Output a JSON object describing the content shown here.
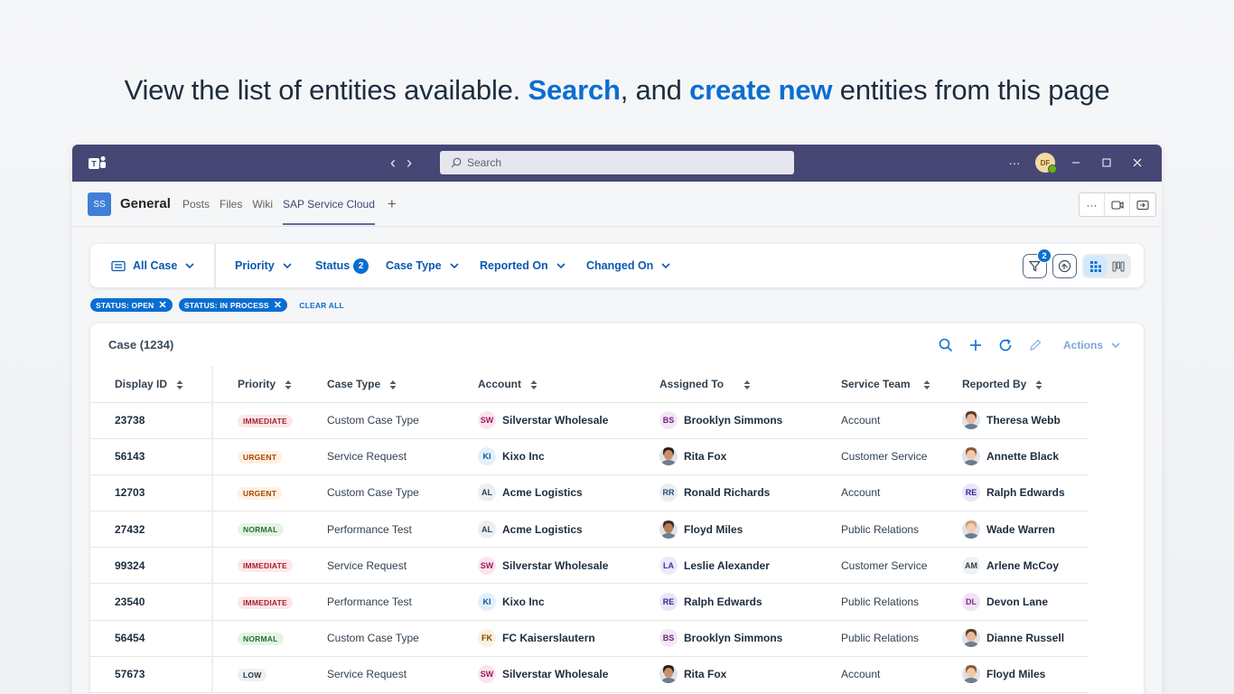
{
  "headline": {
    "part1": "View the list of entities available. ",
    "part2": "Search",
    "part3": ", and ",
    "part4": "create new",
    "part5": " entities from this page"
  },
  "titlebar": {
    "search_placeholder": "Search",
    "avatar_initials": "DF",
    "more": "···"
  },
  "channel": {
    "badge": "SS",
    "title": "General",
    "tabs": [
      "Posts",
      "Files",
      "Wiki",
      "SAP Service Cloud"
    ],
    "active_tab": "SAP Service Cloud",
    "more": "···"
  },
  "filterbar": {
    "variant": "All Case",
    "filters": [
      {
        "label": "Priority"
      },
      {
        "label": "Status",
        "count": "2"
      },
      {
        "label": "Case Type"
      },
      {
        "label": "Reported On"
      },
      {
        "label": "Changed On"
      }
    ],
    "filter_badge": "2"
  },
  "chips": [
    "STATUS: OPEN",
    "STATUS: IN PROCESS"
  ],
  "clear_all": "CLEAR ALL",
  "card": {
    "title": "Case (1234)",
    "actions_label": "Actions"
  },
  "table": {
    "columns": [
      "Display ID",
      "Priority",
      "Case Type",
      "Account",
      "Assigned To",
      "Service Team",
      "Reported By"
    ],
    "rows": [
      {
        "id": "23738",
        "priority": "IMMEDIATE",
        "case_type": "Custom Case Type",
        "account": "Silverstar Wholesale",
        "account_ini": "SW",
        "assigned": "Brooklyn Simmons",
        "assigned_ini": "BS",
        "team": "Account",
        "reported": "Theresa Webb",
        "reported_ini": ""
      },
      {
        "id": "56143",
        "priority": "URGENT",
        "case_type": "Service Request",
        "account": "Kixo Inc",
        "account_ini": "KI",
        "assigned": "Rita Fox",
        "assigned_ini": "",
        "team": "Customer Service",
        "reported": "Annette Black",
        "reported_ini": ""
      },
      {
        "id": "12703",
        "priority": "URGENT",
        "case_type": "Custom Case Type",
        "account": "Acme Logistics",
        "account_ini": "AL",
        "assigned": "Ronald Richards",
        "assigned_ini": "RR",
        "team": "Account",
        "reported": "Ralph Edwards",
        "reported_ini": "RE"
      },
      {
        "id": "27432",
        "priority": "NORMAL",
        "case_type": "Performance Test",
        "account": "Acme Logistics",
        "account_ini": "AL",
        "assigned": "Floyd Miles",
        "assigned_ini": "",
        "team": "Public Relations",
        "reported": "Wade Warren",
        "reported_ini": ""
      },
      {
        "id": "99324",
        "priority": "IMMEDIATE",
        "case_type": "Service Request",
        "account": "Silverstar Wholesale",
        "account_ini": "SW",
        "assigned": "Leslie Alexander",
        "assigned_ini": "LA",
        "team": "Customer Service",
        "reported": "Arlene McCoy",
        "reported_ini": "AM"
      },
      {
        "id": "23540",
        "priority": "IMMEDIATE",
        "case_type": "Performance Test",
        "account": "Kixo Inc",
        "account_ini": "KI",
        "assigned": "Ralph Edwards",
        "assigned_ini": "RE",
        "team": "Public Relations",
        "reported": "Devon Lane",
        "reported_ini": "DL"
      },
      {
        "id": "56454",
        "priority": "NORMAL",
        "case_type": "Custom Case Type",
        "account": "FC Kaiserslautern",
        "account_ini": "FK",
        "assigned": "Brooklyn Simmons",
        "assigned_ini": "BS",
        "team": "Public Relations",
        "reported": "Dianne Russell",
        "reported_ini": ""
      },
      {
        "id": "57673",
        "priority": "LOW",
        "case_type": "Service Request",
        "account": "Silverstar Wholesale",
        "account_ini": "SW",
        "assigned": "Rita Fox",
        "assigned_ini": "",
        "team": "Account",
        "reported": "Floyd Miles",
        "reported_ini": ""
      }
    ]
  },
  "colors": {
    "teams_purple": "#464775",
    "accent_blue": "#0a6ed1",
    "link_blue": "#0a59b0"
  }
}
